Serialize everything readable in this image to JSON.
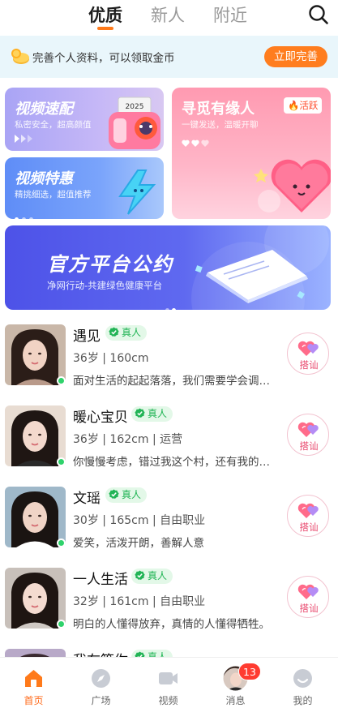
{
  "header": {
    "tabs": [
      {
        "label": "优质",
        "active": true
      },
      {
        "label": "新人",
        "active": false
      },
      {
        "label": "附近",
        "active": false
      }
    ],
    "accent_color": "#ff7a1a"
  },
  "promo": {
    "text": "完善个人资料，可以领取金币",
    "button_label": "立即完善"
  },
  "features": {
    "video_match": {
      "title": "视频速配",
      "subtitle": "私密安全，超高颜值",
      "sticker": "2025"
    },
    "video_deal": {
      "title": "视频特惠",
      "subtitle": "精挑细选，超值推荐"
    },
    "find_match": {
      "title": "寻觅有缘人",
      "subtitle": "一键发送，温暖开聊",
      "badge": "活跃"
    }
  },
  "banner": {
    "title": "官方平台公约",
    "subtitle": "净网行动-共建绿色健康平台"
  },
  "users": [
    {
      "name": "遇见",
      "verified_label": "真人",
      "info": "36岁 | 160cm",
      "bio": "面对生活的起起落落，我们需要学会调整心态",
      "online": true,
      "chat_label": "搭讪"
    },
    {
      "name": "暖心宝贝",
      "verified_label": "真人",
      "info": "36岁 | 162cm | 运营",
      "bio": "你慢慢考虑，错过我这个村，还有我的下一个村",
      "online": true,
      "chat_label": "搭讪"
    },
    {
      "name": "文瑶",
      "verified_label": "真人",
      "info": "30岁 | 165cm | 自由职业",
      "bio": "爱笑，活泼开朗，善解人意",
      "online": true,
      "chat_label": "搭讪"
    },
    {
      "name": "一人生活",
      "verified_label": "真人",
      "info": "32岁 | 161cm | 自由职业",
      "bio": "明白的人懂得放弃，真情的人懂得牺牲。",
      "online": true,
      "chat_label": "搭讪"
    },
    {
      "name": "我在等你",
      "verified_label": "真人",
      "info": "",
      "bio": "",
      "online": true,
      "chat_label": ""
    }
  ],
  "bottom_nav": [
    {
      "label": "首页",
      "icon": "home-icon",
      "active": true
    },
    {
      "label": "广场",
      "icon": "compass-icon",
      "active": false
    },
    {
      "label": "视频",
      "icon": "video-icon",
      "active": false
    },
    {
      "label": "消息",
      "icon": "message-avatar",
      "active": false,
      "badge": "13"
    },
    {
      "label": "我的",
      "icon": "profile-icon",
      "active": false
    }
  ]
}
